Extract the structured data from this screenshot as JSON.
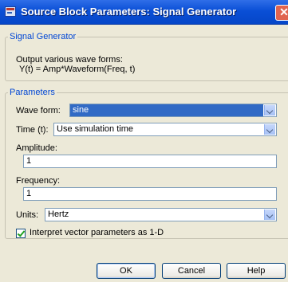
{
  "window": {
    "title": "Source Block Parameters: Signal Generator",
    "close_glyph": "✕"
  },
  "block_group": {
    "legend": "Signal Generator",
    "description_line1": "Output various wave forms:",
    "description_line2": "Y(t) = Amp*Waveform(Freq, t)"
  },
  "params_group": {
    "legend": "Parameters",
    "wave_form": {
      "label": "Wave form:",
      "value": "sine"
    },
    "time": {
      "label": "Time (t):",
      "value": "Use simulation time"
    },
    "amplitude": {
      "label": "Amplitude:",
      "value": "1"
    },
    "frequency": {
      "label": "Frequency:",
      "value": "1"
    },
    "units": {
      "label": "Units:",
      "value": "Hertz"
    },
    "interpret_checkbox": {
      "label": "Interpret vector parameters as 1-D",
      "checked": true
    }
  },
  "buttons": {
    "ok": "OK",
    "cancel": "Cancel",
    "help": "Help"
  },
  "icons": {
    "app": "block-parameters-icon",
    "dropdown": "chevron-down-icon",
    "check": "checkmark-icon"
  },
  "colors": {
    "titlebar": "#0a4fd6",
    "group_legend": "#0046d5",
    "selection": "#316ac5",
    "dialog_bg": "#ece9d8"
  }
}
